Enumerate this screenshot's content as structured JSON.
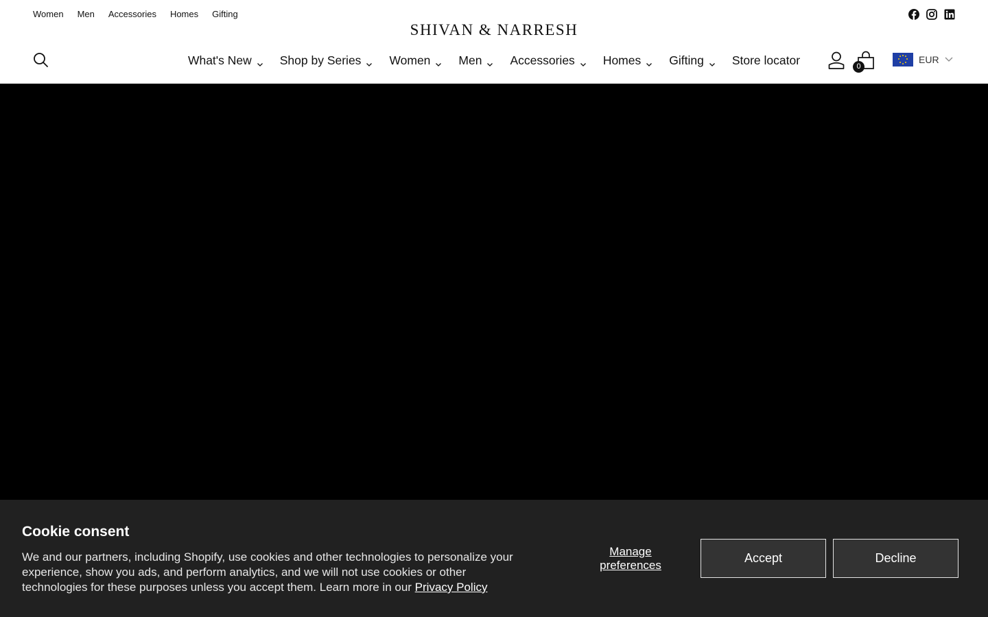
{
  "topnav": {
    "items": [
      {
        "label": "Women"
      },
      {
        "label": "Men"
      },
      {
        "label": "Accessories"
      },
      {
        "label": "Homes"
      },
      {
        "label": "Gifting"
      }
    ]
  },
  "brand": {
    "name": "SHIVAN & NARRESH"
  },
  "social": {
    "icons": [
      "facebook-icon",
      "instagram-icon",
      "linkedin-icon"
    ]
  },
  "mainnav": {
    "items": [
      {
        "label": "What's New",
        "has_dropdown": true
      },
      {
        "label": "Shop by Series",
        "has_dropdown": true
      },
      {
        "label": "Women",
        "has_dropdown": true
      },
      {
        "label": "Men",
        "has_dropdown": true
      },
      {
        "label": "Accessories",
        "has_dropdown": true
      },
      {
        "label": "Homes",
        "has_dropdown": true
      },
      {
        "label": "Gifting",
        "has_dropdown": true
      },
      {
        "label": "Store locator",
        "has_dropdown": false
      }
    ]
  },
  "header_actions": {
    "search_icon": "search-icon",
    "account_icon": "account-icon",
    "cart_icon": "cart-icon",
    "cart_count": "0",
    "currency": "EUR",
    "currency_flag": "eu-flag"
  },
  "hero": {
    "background": "#000000"
  },
  "cookie": {
    "title": "Cookie consent",
    "text": "We and our partners, including Shopify, use cookies and other technologies to personalize your experience, show you ads, and perform analytics, and we will not use cookies or other technologies for these purposes unless you accept them. Learn more in our ",
    "privacy_link": "Privacy Policy",
    "manage_label": "Manage preferences",
    "accept_label": "Accept",
    "decline_label": "Decline",
    "background": "#212121"
  }
}
